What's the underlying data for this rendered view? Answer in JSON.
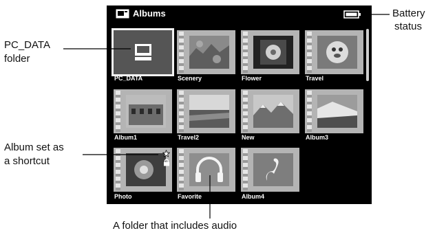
{
  "window": {
    "title": "Albums"
  },
  "albums": [
    {
      "label": "PC_DATA",
      "icon": "computer-icon"
    },
    {
      "label": "Scenery",
      "icon": "scenery-thumbnail"
    },
    {
      "label": "Flower",
      "icon": "flower-thumbnail"
    },
    {
      "label": "Travel",
      "icon": "travel-thumbnail"
    },
    {
      "label": "Album1",
      "icon": "building-thumbnail"
    },
    {
      "label": "Travel2",
      "icon": "landscape-thumbnail"
    },
    {
      "label": "New",
      "icon": "mountain-thumbnail"
    },
    {
      "label": "Album3",
      "icon": "coast-thumbnail"
    },
    {
      "label": "Photo",
      "icon": "flower-thumbnail"
    },
    {
      "label": "Favorite",
      "icon": "headphones-icon"
    },
    {
      "label": "Album4",
      "icon": "swan-thumbnail"
    }
  ],
  "callouts": {
    "battery_line1": "Battery",
    "battery_line2": "status",
    "pcdata_line1": "PC_DATA",
    "pcdata_line2": "folder",
    "shortcut_line1": "Album set as",
    "shortcut_line2": "a shortcut",
    "audio": "A folder that includes audio"
  },
  "colors": {
    "screen_bg": "#000000",
    "tile": "#b4b4b4",
    "selected_outline": "#f2f2f2"
  }
}
